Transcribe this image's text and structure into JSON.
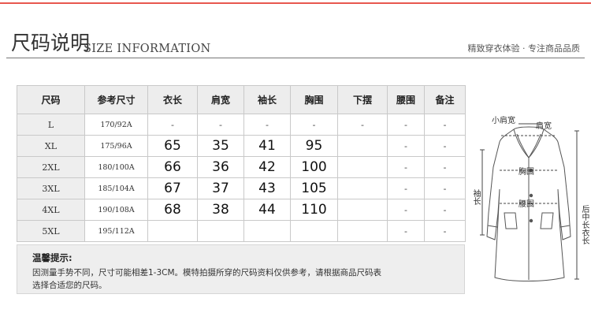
{
  "header": {
    "title_zh": "尺码说明",
    "title_en": "SIZE INFORMATION",
    "tagline": "精致穿衣体验 · 专注商品品质"
  },
  "table": {
    "headers": [
      "尺码",
      "参考尺寸",
      "衣长",
      "肩宽",
      "袖长",
      "胸围",
      "下摆",
      "腰围",
      "备注"
    ],
    "rows": [
      {
        "size": "L",
        "ref": "170/92A",
        "length": "-",
        "shoulder": "-",
        "sleeve": "-",
        "bust": "-",
        "hem": "-",
        "waist": "-",
        "note": "-"
      },
      {
        "size": "XL",
        "ref": "175/96A",
        "length": "65",
        "shoulder": "35",
        "sleeve": "41",
        "bust": "95",
        "hem": "",
        "waist": "-",
        "note": "-"
      },
      {
        "size": "2XL",
        "ref": "180/100A",
        "length": "66",
        "shoulder": "36",
        "sleeve": "42",
        "bust": "100",
        "hem": "",
        "waist": "-",
        "note": "-"
      },
      {
        "size": "3XL",
        "ref": "185/104A",
        "length": "67",
        "shoulder": "37",
        "sleeve": "43",
        "bust": "105",
        "hem": "",
        "waist": "-",
        "note": "-"
      },
      {
        "size": "4XL",
        "ref": "190/108A",
        "length": "68",
        "shoulder": "38",
        "sleeve": "44",
        "bust": "110",
        "hem": "",
        "waist": "-",
        "note": "-"
      },
      {
        "size": "5XL",
        "ref": "195/112A",
        "length": "",
        "shoulder": "",
        "sleeve": "",
        "bust": "",
        "hem": "",
        "waist": "-",
        "note": "-"
      }
    ]
  },
  "notes": {
    "title": "温馨提示:",
    "line1": "因测量手势不同，尺寸可能相差1-3CM。模特拍摄所穿的尺码资料仅供参考，请根据商品尺码表",
    "line2": "选择合适您的尺码。"
  },
  "diagram": {
    "small_shoulder": "小肩宽",
    "shoulder": "肩宽",
    "bust": "胸围",
    "waist": "腰围",
    "sleeve": "袖长",
    "back_length": "后中长衣长"
  }
}
